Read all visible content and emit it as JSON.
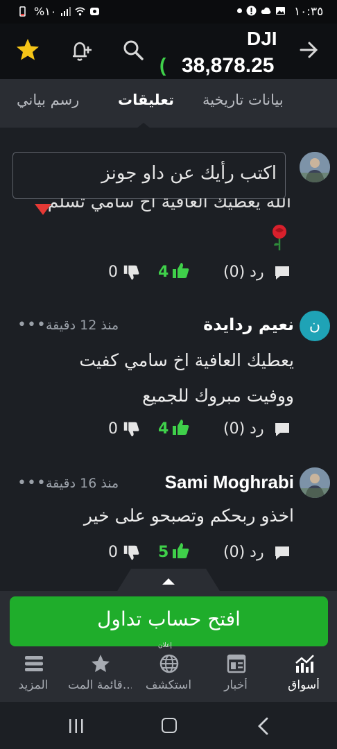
{
  "status_bar": {
    "time": "١٠:٣٥",
    "battery": "%١٠"
  },
  "header": {
    "ticker": "DJI",
    "price": "38,878.25",
    "change_fragment": "("
  },
  "tabs": [
    {
      "label": "بيانات تاريخية",
      "active": false
    },
    {
      "label": "تعليقات",
      "active": true
    },
    {
      "label": "رسم بياني",
      "active": false
    }
  ],
  "comment_input": {
    "placeholder": "اكتب رأيك عن داو جونز"
  },
  "comments": [
    {
      "text_clipped": "الله يعطيك العافية اخ سامي تسلم",
      "reply_label": "رد (0)",
      "likes": "4",
      "dislikes": "0"
    },
    {
      "avatar_letter": "ن",
      "username": "نعيم ردايدة",
      "time_ago": "منذ 12 دقيقة",
      "text_line1": "يعطيك العافية اخ سامي كفيت",
      "text_line2": "ووفيت مبروك للجميع",
      "reply_label": "رد (0)",
      "likes": "4",
      "dislikes": "0"
    },
    {
      "username": "Sami Moghrabi",
      "time_ago": "منذ 16 دقيقة",
      "text_line1": "اخذو ربحكم وتصبحو على خير",
      "reply_label": "رد (0)",
      "likes": "5",
      "dislikes": "0"
    }
  ],
  "more_menu": "•••",
  "cta": {
    "label": "افتح حساب تداول",
    "sub": "إعلان"
  },
  "bottom_nav": [
    {
      "label": "أسواق",
      "icon": "markets-chart-icon",
      "active": true
    },
    {
      "label": "أخبار",
      "icon": "news-icon",
      "active": false
    },
    {
      "label": "استكشف",
      "icon": "globe-icon",
      "active": false
    },
    {
      "label": "قائمة المت...",
      "icon": "star-icon",
      "active": false
    },
    {
      "label": "المزيد",
      "icon": "menu-icon",
      "active": false
    }
  ],
  "colors": {
    "accent_green": "#1fad2b",
    "like_green": "#3fd04a",
    "star_yellow": "#f5c518",
    "background": "#1c1f24"
  }
}
